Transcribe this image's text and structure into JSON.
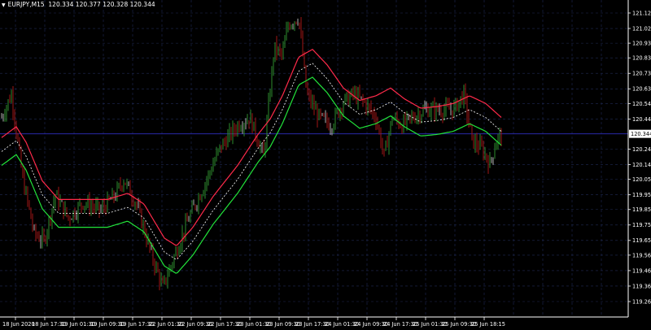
{
  "header": {
    "menu_icon": "triangle-down-icon",
    "symbol": "EURJPY,M15",
    "quote": "120.334 120.377 120.328 120.344"
  },
  "price_axis": {
    "labels": [
      "121.125",
      "121.025",
      "120.930",
      "120.835",
      "120.735",
      "120.635",
      "120.540",
      "120.440",
      "120.344",
      "120.245",
      "120.145",
      "120.050",
      "119.950",
      "119.855",
      "119.755",
      "119.655",
      "119.560",
      "119.460",
      "119.360",
      "119.260"
    ],
    "current": "120.344"
  },
  "time_axis": {
    "labels": [
      "18 Jun 2020",
      "18 Jun 17:30",
      "19 Jun 01:30",
      "19 Jun 09:30",
      "19 Jun 17:30",
      "22 Jun 01:30",
      "22 Jun 09:30",
      "22 Jun 17:30",
      "23 Jun 01:30",
      "23 Jun 09:30",
      "23 Jun 17:30",
      "24 Jun 01:30",
      "24 Jun 09:30",
      "24 Jun 17:30",
      "25 Jun 01:30",
      "25 Jun 09:30",
      "25 Jun 18:15"
    ]
  },
  "colors": {
    "background": "#000000",
    "grid": "#1f2a55",
    "bull": "#2e8b2e",
    "bear": "#a01616",
    "neutral": "#b0b0b0",
    "upper_band": "#ff2a4a",
    "lower_band": "#22e33a",
    "mid_band": "#ffffff",
    "current_line": "#2a2aa8"
  },
  "chart_data": {
    "type": "candlestick",
    "symbol": "EURJPY",
    "timeframe": "M15",
    "ylim": [
      119.21,
      121.2
    ],
    "current_price": 120.344,
    "close_path": [
      {
        "t": 0,
        "p": 120.45
      },
      {
        "t": 12,
        "p": 120.6
      },
      {
        "t": 26,
        "p": 120.05
      },
      {
        "t": 40,
        "p": 119.7
      },
      {
        "t": 52,
        "p": 119.65
      },
      {
        "t": 66,
        "p": 119.95
      },
      {
        "t": 82,
        "p": 119.8
      },
      {
        "t": 100,
        "p": 119.9
      },
      {
        "t": 122,
        "p": 119.85
      },
      {
        "t": 140,
        "p": 119.95
      },
      {
        "t": 150,
        "p": 120.05
      },
      {
        "t": 165,
        "p": 119.9
      },
      {
        "t": 185,
        "p": 119.55
      },
      {
        "t": 198,
        "p": 119.35
      },
      {
        "t": 212,
        "p": 119.55
      },
      {
        "t": 230,
        "p": 119.8
      },
      {
        "t": 248,
        "p": 120.0
      },
      {
        "t": 268,
        "p": 120.25
      },
      {
        "t": 290,
        "p": 120.4
      },
      {
        "t": 305,
        "p": 120.45
      },
      {
        "t": 322,
        "p": 120.2
      },
      {
        "t": 335,
        "p": 120.9
      },
      {
        "t": 345,
        "p": 120.85
      },
      {
        "t": 352,
        "p": 121.05
      },
      {
        "t": 365,
        "p": 121.1
      },
      {
        "t": 375,
        "p": 120.6
      },
      {
        "t": 390,
        "p": 120.45
      },
      {
        "t": 405,
        "p": 120.4
      },
      {
        "t": 420,
        "p": 120.55
      },
      {
        "t": 432,
        "p": 120.6
      },
      {
        "t": 445,
        "p": 120.55
      },
      {
        "t": 460,
        "p": 120.45
      },
      {
        "t": 470,
        "p": 120.2
      },
      {
        "t": 480,
        "p": 120.45
      },
      {
        "t": 492,
        "p": 120.4
      },
      {
        "t": 505,
        "p": 120.45
      },
      {
        "t": 520,
        "p": 120.5
      },
      {
        "t": 540,
        "p": 120.5
      },
      {
        "t": 555,
        "p": 120.5
      },
      {
        "t": 568,
        "p": 120.6
      },
      {
        "t": 578,
        "p": 120.3
      },
      {
        "t": 590,
        "p": 120.25
      },
      {
        "t": 600,
        "p": 120.15
      },
      {
        "t": 608,
        "p": 120.3
      },
      {
        "t": 614,
        "p": 120.344
      }
    ],
    "band_mid": [
      {
        "t": 0,
        "p": 120.23
      },
      {
        "t": 18,
        "p": 120.3
      },
      {
        "t": 30,
        "p": 120.2
      },
      {
        "t": 50,
        "p": 119.95
      },
      {
        "t": 70,
        "p": 119.83
      },
      {
        "t": 100,
        "p": 119.83
      },
      {
        "t": 130,
        "p": 119.83
      },
      {
        "t": 155,
        "p": 119.87
      },
      {
        "t": 175,
        "p": 119.8
      },
      {
        "t": 200,
        "p": 119.58
      },
      {
        "t": 215,
        "p": 119.53
      },
      {
        "t": 235,
        "p": 119.65
      },
      {
        "t": 260,
        "p": 119.85
      },
      {
        "t": 290,
        "p": 120.05
      },
      {
        "t": 315,
        "p": 120.25
      },
      {
        "t": 330,
        "p": 120.35
      },
      {
        "t": 345,
        "p": 120.5
      },
      {
        "t": 365,
        "p": 120.75
      },
      {
        "t": 382,
        "p": 120.8
      },
      {
        "t": 400,
        "p": 120.7
      },
      {
        "t": 420,
        "p": 120.55
      },
      {
        "t": 440,
        "p": 120.47
      },
      {
        "t": 460,
        "p": 120.5
      },
      {
        "t": 478,
        "p": 120.55
      },
      {
        "t": 495,
        "p": 120.48
      },
      {
        "t": 515,
        "p": 120.42
      },
      {
        "t": 535,
        "p": 120.43
      },
      {
        "t": 555,
        "p": 120.45
      },
      {
        "t": 575,
        "p": 120.5
      },
      {
        "t": 595,
        "p": 120.45
      },
      {
        "t": 614,
        "p": 120.36
      }
    ],
    "band_width": 0.09
  }
}
